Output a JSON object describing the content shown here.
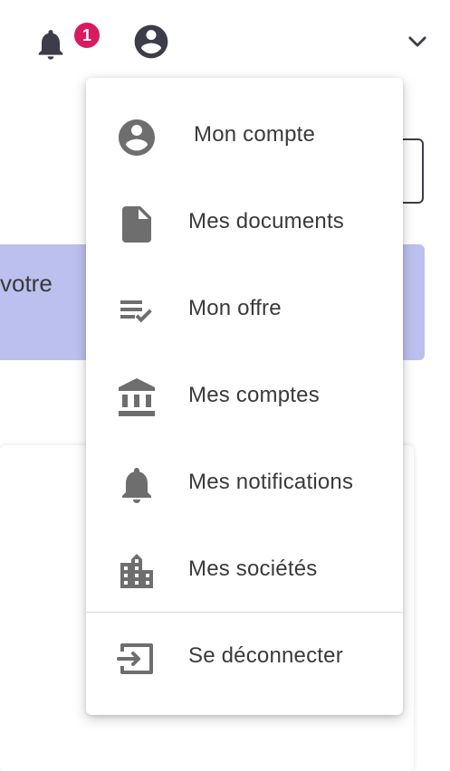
{
  "topbar": {
    "notification_count": "1",
    "icons": [
      "bell-icon",
      "account-circle-icon",
      "chevron-down-icon"
    ]
  },
  "background": {
    "banner_text": "votre"
  },
  "menu": {
    "items": [
      {
        "label": "Mon compte",
        "icon": "account-circle-icon"
      },
      {
        "label": "Mes documents",
        "icon": "document-icon"
      },
      {
        "label": "Mon offre",
        "icon": "playlist-check-icon"
      },
      {
        "label": "Mes comptes",
        "icon": "bank-icon"
      },
      {
        "label": "Mes notifications",
        "icon": "bell-icon"
      },
      {
        "label": "Mes sociétés",
        "icon": "building-icon"
      }
    ],
    "logout": {
      "label": "Se déconnecter",
      "icon": "logout-icon"
    }
  },
  "colors": {
    "badge": "#d81b60",
    "banner": "#bcc0ee",
    "icon_dark": "#3c3c4a",
    "icon_menu": "#6e6e6e"
  }
}
